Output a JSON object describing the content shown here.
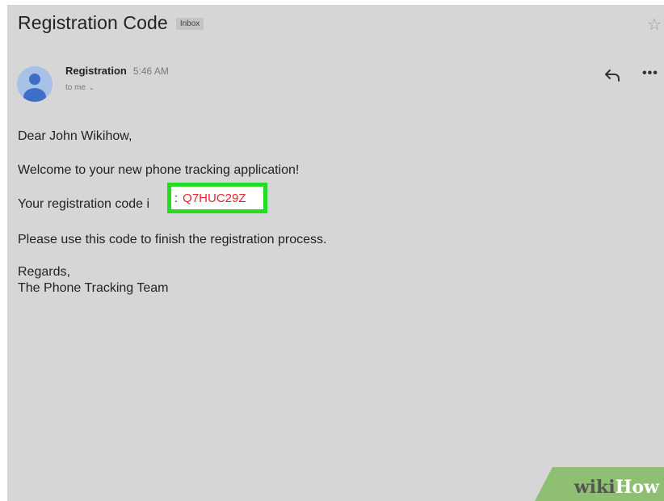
{
  "email": {
    "subject": "Registration Code",
    "label": "Inbox",
    "sender": "Registration",
    "time": "5:46 AM",
    "to": "to me",
    "body": {
      "greeting": "Dear John Wikihow,",
      "line1": "Welcome to your new phone tracking application!",
      "line2_prefix": "Your registration code i",
      "line2_colon": ":",
      "code": "Q7HUC29Z",
      "line3": "Please use this code to finish the registration process.",
      "regards": "Regards,",
      "signature": "The Phone Tracking Team"
    }
  },
  "icons": {
    "star": "star-icon",
    "avatar": "person-avatar-icon",
    "chevron": "chevron-down-icon",
    "reply": "reply-icon",
    "more": "more-horizontal-icon"
  },
  "glyphs": {
    "star": "☆",
    "chevron": "⌄",
    "more": "•••"
  },
  "colors": {
    "background": "#d6d6d6",
    "highlight_border": "#22dd22",
    "code_text": "#ee2233",
    "avatar_bg": "#a8c1e6",
    "avatar_fg": "#3e6fc8",
    "watermark_green": "#8fbf72"
  },
  "watermark": {
    "wiki": "wiki",
    "how": "How"
  }
}
